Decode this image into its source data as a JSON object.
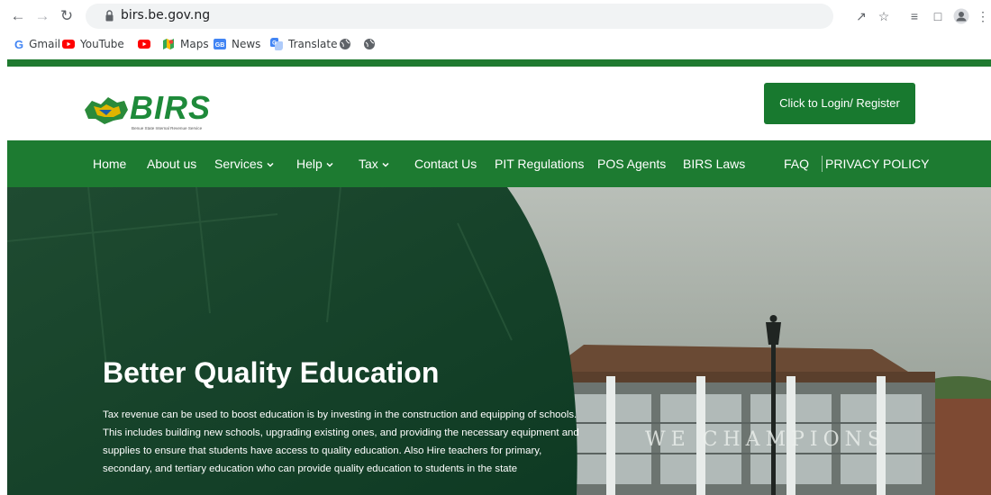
{
  "browser": {
    "url": "birs.be.gov.ng",
    "bookmarks": [
      {
        "label": "Gmail",
        "icon": "google-icon"
      },
      {
        "label": "YouTube",
        "icon": "youtube-icon"
      },
      {
        "label": "",
        "icon": "youtube-icon"
      },
      {
        "label": "Maps",
        "icon": "maps-icon"
      },
      {
        "label": "News",
        "icon": "news-icon"
      },
      {
        "label": "Translate",
        "icon": "translate-icon"
      },
      {
        "label": "",
        "icon": "globe-icon"
      },
      {
        "label": "",
        "icon": "globe-icon"
      }
    ]
  },
  "site": {
    "logo_text": "BIRS",
    "logo_subtitle": "Benue State Internal Revenue Service",
    "login_button": "Click to Login/ Register",
    "nav": {
      "home": "Home",
      "about": "About us",
      "services": "Services",
      "help": "Help",
      "tax": "Tax",
      "contact": "Contact Us",
      "pit": "PIT Regulations",
      "pos": "POS Agents",
      "laws": "BIRS Laws",
      "faq": "FAQ",
      "privacy": "PRIVACY POLICY"
    },
    "hero": {
      "title": "Better Quality Education",
      "body": "Tax revenue can be used to boost education is by investing in the construction and equipping of schools. This includes building new schools, upgrading existing ones, and providing the necessary equipment and supplies to ensure that students have access to quality education. Also Hire teachers for primary, secondary, and tertiary education who can provide quality education to students in the state",
      "sign_text": "WE CHAMPIONS"
    }
  },
  "colors": {
    "brand_green": "#1d7b31",
    "hero_dark_green": "#11412a"
  }
}
